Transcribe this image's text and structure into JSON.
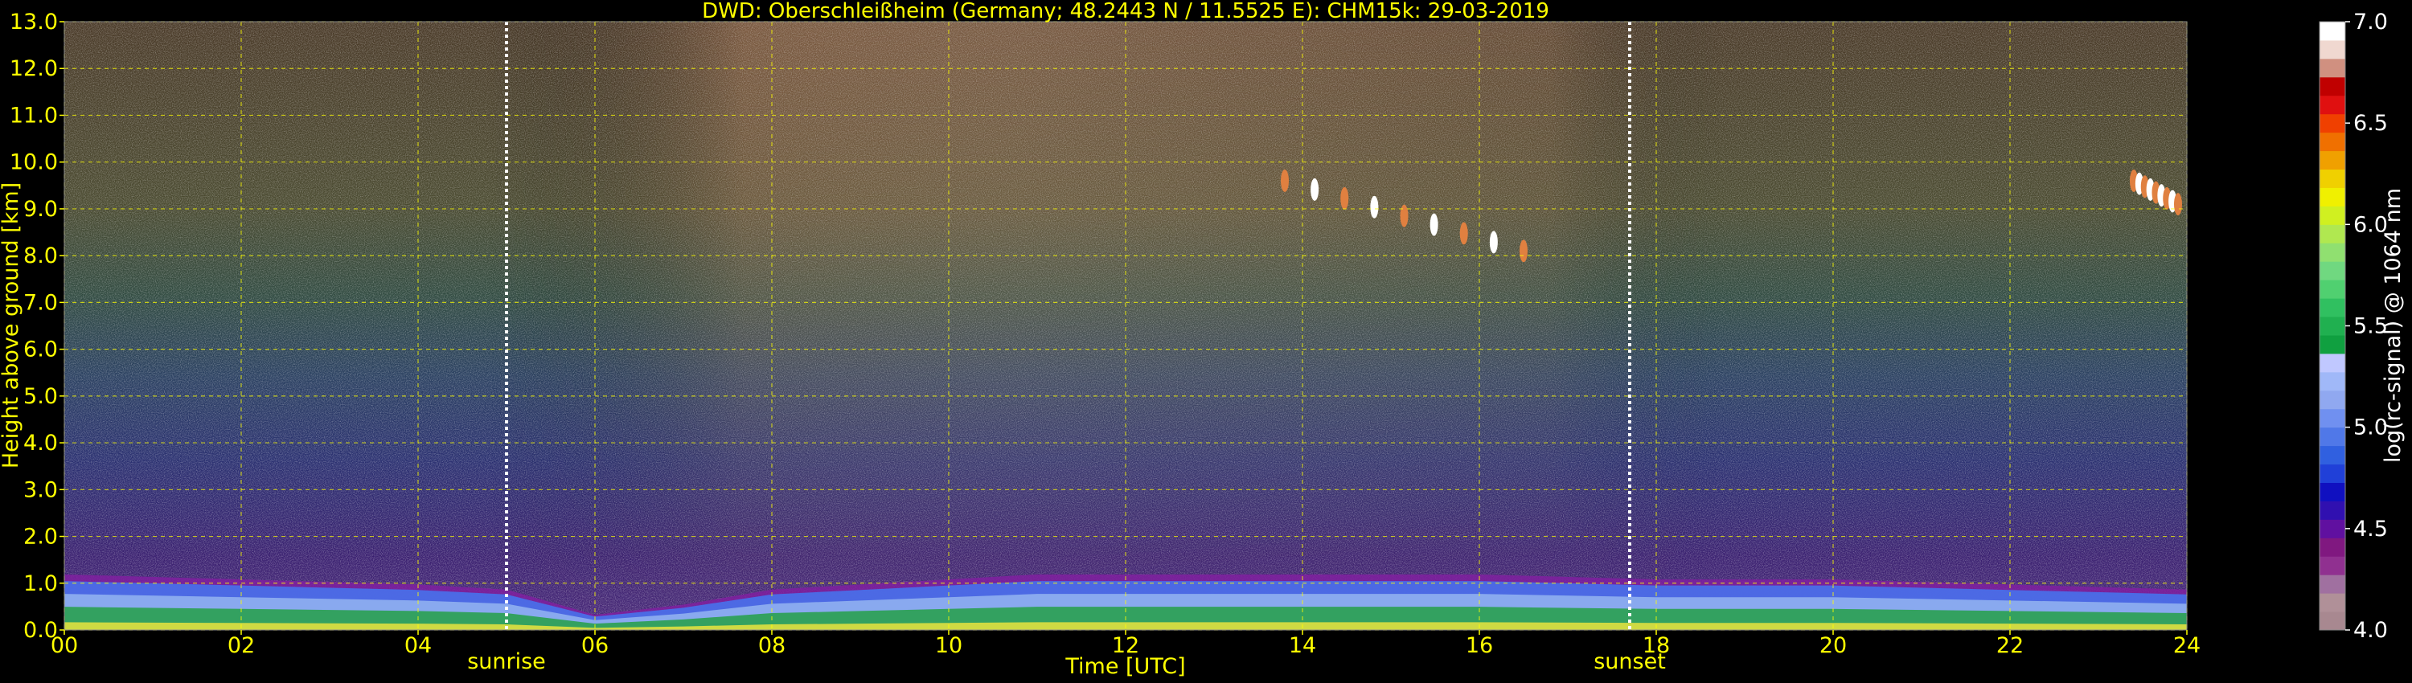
{
  "chart_data": {
    "type": "heatmap",
    "title": "DWD: Oberschleißheim (Germany; 48.2443 N / 11.5525 E):    CHM15k: 29-03-2019",
    "xlabel": "Time [UTC]",
    "ylabel": "Height above ground [km]",
    "x_ticks": [
      "00",
      "02",
      "04",
      "06",
      "08",
      "10",
      "12",
      "14",
      "16",
      "18",
      "20",
      "22",
      "24"
    ],
    "xlim": [
      0,
      24
    ],
    "y_ticks": [
      "0.0",
      "1.0",
      "2.0",
      "3.0",
      "4.0",
      "5.0",
      "6.0",
      "7.0",
      "8.0",
      "9.0",
      "10.0",
      "11.0",
      "12.0",
      "13.0"
    ],
    "ylim": [
      0,
      13
    ],
    "grid": true,
    "grid_color": "#ffff00",
    "markers": [
      {
        "label": "sunrise",
        "time": 5.0
      },
      {
        "label": "sunset",
        "time": 17.7
      }
    ],
    "colorbar": {
      "label": "log(rc-signal) @ 1064 nm",
      "ticks": [
        "4.0",
        "4.5",
        "5.0",
        "5.5",
        "6.0",
        "6.5",
        "7.0"
      ],
      "range": [
        4.0,
        7.0
      ],
      "colors": [
        "#a88890",
        "#b09098",
        "#a070a0",
        "#903090",
        "#801880",
        "#6010a0",
        "#3010b0",
        "#1010c0",
        "#2040d8",
        "#3060e0",
        "#5078e8",
        "#7090f0",
        "#90a8f0",
        "#a0b8f8",
        "#c0c8ff",
        "#10a040",
        "#20b050",
        "#30c060",
        "#50d070",
        "#70d880",
        "#90e070",
        "#b0e850",
        "#d0f020",
        "#f0f000",
        "#f0d000",
        "#f0a000",
        "#f07000",
        "#f04000",
        "#e01010",
        "#c00000",
        "#d09080",
        "#f0d8d0",
        "#ffffff"
      ]
    },
    "layers_description_free": false,
    "boundary_layer_top_km": [
      [
        0,
        1.1
      ],
      [
        2,
        1.0
      ],
      [
        4,
        0.9
      ],
      [
        5,
        0.8
      ],
      [
        6,
        0.3
      ],
      [
        7,
        0.5
      ],
      [
        8,
        0.8
      ],
      [
        9,
        0.9
      ],
      [
        10,
        1.0
      ],
      [
        11,
        1.1
      ],
      [
        12,
        1.1
      ],
      [
        14,
        1.1
      ],
      [
        16,
        1.1
      ],
      [
        18,
        1.0
      ],
      [
        20,
        1.0
      ],
      [
        22,
        0.9
      ],
      [
        24,
        0.8
      ]
    ],
    "cirrus_segments": [
      {
        "t0": 13.8,
        "t1": 16.5,
        "h0": 9.6,
        "h1": 8.1
      },
      {
        "t0": 23.4,
        "t1": 23.9,
        "h0": 9.6,
        "h1": 9.1
      }
    ]
  }
}
